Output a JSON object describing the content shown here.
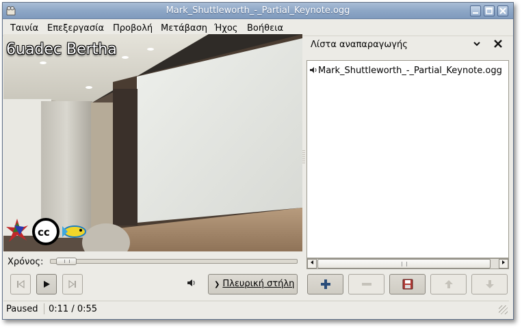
{
  "window": {
    "title": "Mark_Shuttleworth_-_Partial_Keynote.ogg",
    "controls": [
      "minimize",
      "maximize",
      "close"
    ]
  },
  "menu": {
    "items": [
      "Ταινία",
      "Επεξεργασία",
      "Προβολή",
      "Μετάβαση",
      "Ήχος",
      "Βοήθεια"
    ]
  },
  "video": {
    "overlay_text": "6uadec Bertha"
  },
  "controls": {
    "time_label": "Χρόνος:",
    "seek_progress_percent": 20,
    "sidebar_button_label": "Πλευρική στήλη",
    "icons": [
      "previous-icon",
      "play-icon",
      "next-icon",
      "volume-icon"
    ]
  },
  "status": {
    "state": "Paused",
    "time": "0:11 / 0:55"
  },
  "sidebar": {
    "title": "Λίστα αναπαραγωγής",
    "playlist": [
      {
        "name": "Mark_Shuttleworth_-_Partial_Keynote.ogg",
        "playing": true
      }
    ],
    "buttons": [
      {
        "name": "add",
        "enabled": true
      },
      {
        "name": "remove",
        "enabled": false
      },
      {
        "name": "save",
        "enabled": true
      },
      {
        "name": "move-up",
        "enabled": false
      },
      {
        "name": "move-down",
        "enabled": false
      }
    ]
  }
}
